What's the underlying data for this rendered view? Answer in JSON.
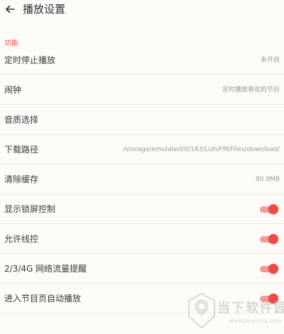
{
  "header": {
    "title": "播放设置",
    "back_icon": "arrow-left-icon"
  },
  "section": {
    "title": "功能",
    "title_color": "#f0524f"
  },
  "rows": [
    {
      "label": "定时停止播放",
      "value": "未开启"
    },
    {
      "label": "闹钟",
      "value": "定时播放喜欢的节目"
    },
    {
      "label": "音质选择",
      "value": ""
    },
    {
      "label": "下载路径",
      "value": "/storage/emulated/0/183/LizhiFM/Files/download/"
    },
    {
      "label": "清除缓存",
      "value": "80.9MB"
    },
    {
      "label": "显示锁屏控制",
      "toggle": true
    },
    {
      "label": "允许线控",
      "toggle": true
    },
    {
      "label": "2/3/4G 网络流量提醒",
      "toggle": true
    },
    {
      "label": "进入节目页自动播放",
      "toggle": true
    }
  ],
  "toggle_colors": {
    "thumb": "#f04a46",
    "track": "#f49a98"
  },
  "watermark": {
    "title": "当下软件园",
    "url": "www.downxia.com"
  }
}
